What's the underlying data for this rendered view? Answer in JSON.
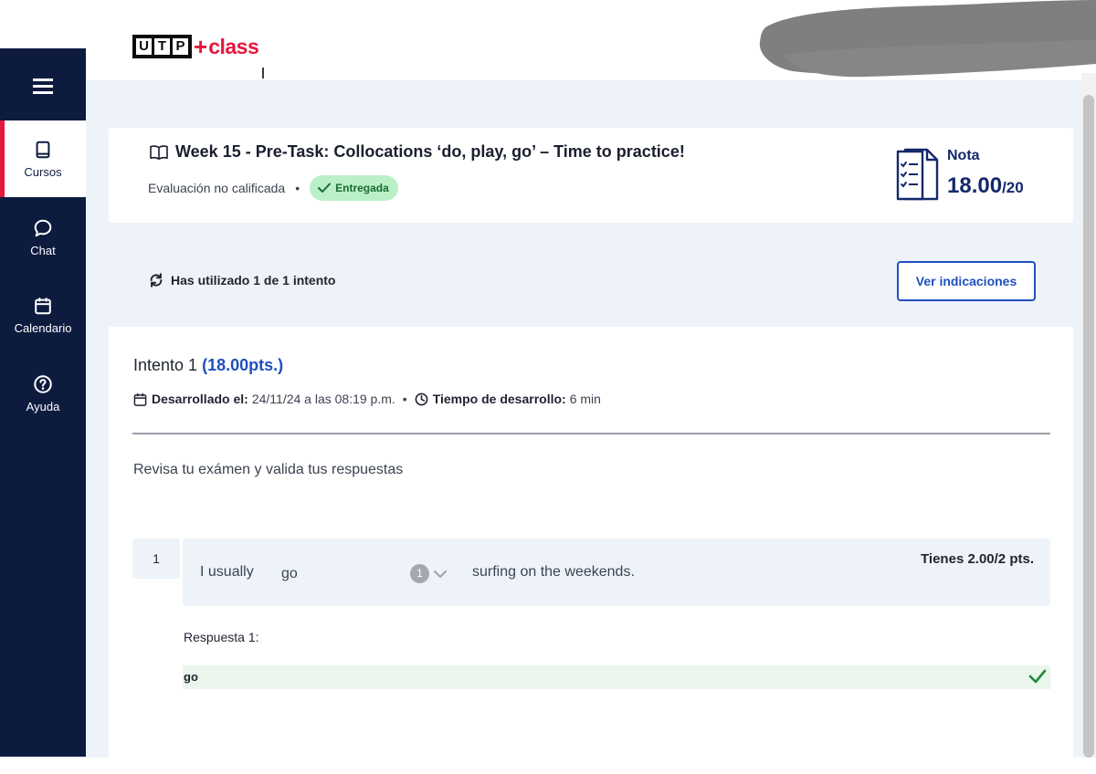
{
  "header": {
    "logo_letters": [
      "U",
      "T",
      "P"
    ],
    "logo_plus": "+",
    "logo_class": "class"
  },
  "sidebar": {
    "items": [
      {
        "label": "Cursos",
        "icon": "book-icon",
        "active": true
      },
      {
        "label": "Chat",
        "icon": "chat-bubble-icon",
        "active": false
      },
      {
        "label": "Calendario",
        "icon": "calendar-icon",
        "active": false
      },
      {
        "label": "Ayuda",
        "icon": "help-circle-icon",
        "active": false
      }
    ]
  },
  "task": {
    "title": "Week 15 - Pre-Task: Collocations ‘do, play, go’ – Time to practice!",
    "evaluation_type": "Evaluación no calificada",
    "status_badge": "Entregada",
    "grade_label": "Nota",
    "grade_value": "18.00",
    "grade_max": "/20"
  },
  "attempts": {
    "used_text": "Has utilizado 1 de 1 intento",
    "instructions_button": "Ver indicaciones"
  },
  "review": {
    "attempt_label": "Intento 1",
    "attempt_points": "(18.00pts.)",
    "developed_label": "Desarrollado el:",
    "developed_value": "24/11/24 a las 08:19 p.m.",
    "duration_label": "Tiempo de desarrollo:",
    "duration_value": "6 min",
    "message": "Revisa tu exámen y valida tus respuestas",
    "question": {
      "number": "1",
      "text_before": "I usually",
      "selected_answer": "go",
      "blank_number": "1",
      "text_after": "surfing on the weekends.",
      "score": "Tienes 2.00/2 pts.",
      "response_label": "Respuesta 1:",
      "response_value": "go"
    }
  },
  "colors": {
    "sidebar_bg": "#0d1b3e",
    "accent_red": "#e5173f",
    "accent_blue": "#1f4fbf",
    "grade_blue": "#14296b",
    "success_green": "#1b8a3c",
    "badge_bg": "#b9f0c8",
    "page_bg": "#eef3fa"
  }
}
